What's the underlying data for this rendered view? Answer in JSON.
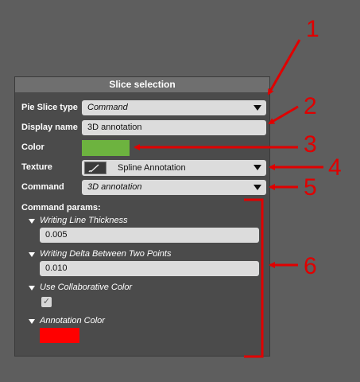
{
  "panel": {
    "title": "Slice selection",
    "rows": {
      "pie_slice_type": {
        "label": "Pie Slice type",
        "value": "Command"
      },
      "display_name": {
        "label": "Display name",
        "value": "3D annotation"
      },
      "color": {
        "label": "Color",
        "swatch_color": "#6db33f"
      },
      "texture": {
        "label": "Texture",
        "value": "Spline Annotation",
        "icon": "brush-icon"
      },
      "command": {
        "label": "Command",
        "value": "3D annotation"
      }
    },
    "command_params": {
      "label": "Command params:",
      "writing_line_thickness": {
        "label": "Writing Line Thickness",
        "value": "0.005"
      },
      "writing_delta": {
        "label": "Writing Delta Between Two Points",
        "value": "0.010"
      },
      "use_collaborative_color": {
        "label": "Use Collaborative Color",
        "checked": true
      },
      "annotation_color": {
        "label": "Annotation Color",
        "swatch_color": "#ff0000"
      }
    }
  },
  "callouts": [
    "1",
    "2",
    "3",
    "4",
    "5",
    "6"
  ],
  "accent_color": "#e00000"
}
